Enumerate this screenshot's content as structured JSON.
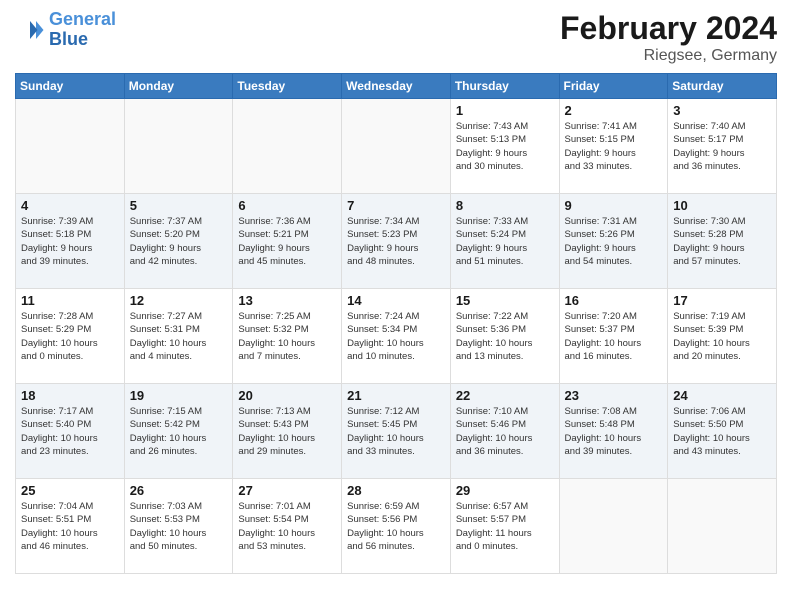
{
  "header": {
    "logo_line1": "General",
    "logo_line2": "Blue",
    "month": "February 2024",
    "location": "Riegsee, Germany"
  },
  "days_of_week": [
    "Sunday",
    "Monday",
    "Tuesday",
    "Wednesday",
    "Thursday",
    "Friday",
    "Saturday"
  ],
  "weeks": [
    {
      "shaded": false,
      "days": [
        {
          "num": "",
          "detail": ""
        },
        {
          "num": "",
          "detail": ""
        },
        {
          "num": "",
          "detail": ""
        },
        {
          "num": "",
          "detail": ""
        },
        {
          "num": "1",
          "detail": "Sunrise: 7:43 AM\nSunset: 5:13 PM\nDaylight: 9 hours\nand 30 minutes."
        },
        {
          "num": "2",
          "detail": "Sunrise: 7:41 AM\nSunset: 5:15 PM\nDaylight: 9 hours\nand 33 minutes."
        },
        {
          "num": "3",
          "detail": "Sunrise: 7:40 AM\nSunset: 5:17 PM\nDaylight: 9 hours\nand 36 minutes."
        }
      ]
    },
    {
      "shaded": true,
      "days": [
        {
          "num": "4",
          "detail": "Sunrise: 7:39 AM\nSunset: 5:18 PM\nDaylight: 9 hours\nand 39 minutes."
        },
        {
          "num": "5",
          "detail": "Sunrise: 7:37 AM\nSunset: 5:20 PM\nDaylight: 9 hours\nand 42 minutes."
        },
        {
          "num": "6",
          "detail": "Sunrise: 7:36 AM\nSunset: 5:21 PM\nDaylight: 9 hours\nand 45 minutes."
        },
        {
          "num": "7",
          "detail": "Sunrise: 7:34 AM\nSunset: 5:23 PM\nDaylight: 9 hours\nand 48 minutes."
        },
        {
          "num": "8",
          "detail": "Sunrise: 7:33 AM\nSunset: 5:24 PM\nDaylight: 9 hours\nand 51 minutes."
        },
        {
          "num": "9",
          "detail": "Sunrise: 7:31 AM\nSunset: 5:26 PM\nDaylight: 9 hours\nand 54 minutes."
        },
        {
          "num": "10",
          "detail": "Sunrise: 7:30 AM\nSunset: 5:28 PM\nDaylight: 9 hours\nand 57 minutes."
        }
      ]
    },
    {
      "shaded": false,
      "days": [
        {
          "num": "11",
          "detail": "Sunrise: 7:28 AM\nSunset: 5:29 PM\nDaylight: 10 hours\nand 0 minutes."
        },
        {
          "num": "12",
          "detail": "Sunrise: 7:27 AM\nSunset: 5:31 PM\nDaylight: 10 hours\nand 4 minutes."
        },
        {
          "num": "13",
          "detail": "Sunrise: 7:25 AM\nSunset: 5:32 PM\nDaylight: 10 hours\nand 7 minutes."
        },
        {
          "num": "14",
          "detail": "Sunrise: 7:24 AM\nSunset: 5:34 PM\nDaylight: 10 hours\nand 10 minutes."
        },
        {
          "num": "15",
          "detail": "Sunrise: 7:22 AM\nSunset: 5:36 PM\nDaylight: 10 hours\nand 13 minutes."
        },
        {
          "num": "16",
          "detail": "Sunrise: 7:20 AM\nSunset: 5:37 PM\nDaylight: 10 hours\nand 16 minutes."
        },
        {
          "num": "17",
          "detail": "Sunrise: 7:19 AM\nSunset: 5:39 PM\nDaylight: 10 hours\nand 20 minutes."
        }
      ]
    },
    {
      "shaded": true,
      "days": [
        {
          "num": "18",
          "detail": "Sunrise: 7:17 AM\nSunset: 5:40 PM\nDaylight: 10 hours\nand 23 minutes."
        },
        {
          "num": "19",
          "detail": "Sunrise: 7:15 AM\nSunset: 5:42 PM\nDaylight: 10 hours\nand 26 minutes."
        },
        {
          "num": "20",
          "detail": "Sunrise: 7:13 AM\nSunset: 5:43 PM\nDaylight: 10 hours\nand 29 minutes."
        },
        {
          "num": "21",
          "detail": "Sunrise: 7:12 AM\nSunset: 5:45 PM\nDaylight: 10 hours\nand 33 minutes."
        },
        {
          "num": "22",
          "detail": "Sunrise: 7:10 AM\nSunset: 5:46 PM\nDaylight: 10 hours\nand 36 minutes."
        },
        {
          "num": "23",
          "detail": "Sunrise: 7:08 AM\nSunset: 5:48 PM\nDaylight: 10 hours\nand 39 minutes."
        },
        {
          "num": "24",
          "detail": "Sunrise: 7:06 AM\nSunset: 5:50 PM\nDaylight: 10 hours\nand 43 minutes."
        }
      ]
    },
    {
      "shaded": false,
      "days": [
        {
          "num": "25",
          "detail": "Sunrise: 7:04 AM\nSunset: 5:51 PM\nDaylight: 10 hours\nand 46 minutes."
        },
        {
          "num": "26",
          "detail": "Sunrise: 7:03 AM\nSunset: 5:53 PM\nDaylight: 10 hours\nand 50 minutes."
        },
        {
          "num": "27",
          "detail": "Sunrise: 7:01 AM\nSunset: 5:54 PM\nDaylight: 10 hours\nand 53 minutes."
        },
        {
          "num": "28",
          "detail": "Sunrise: 6:59 AM\nSunset: 5:56 PM\nDaylight: 10 hours\nand 56 minutes."
        },
        {
          "num": "29",
          "detail": "Sunrise: 6:57 AM\nSunset: 5:57 PM\nDaylight: 11 hours\nand 0 minutes."
        },
        {
          "num": "",
          "detail": ""
        },
        {
          "num": "",
          "detail": ""
        }
      ]
    }
  ]
}
